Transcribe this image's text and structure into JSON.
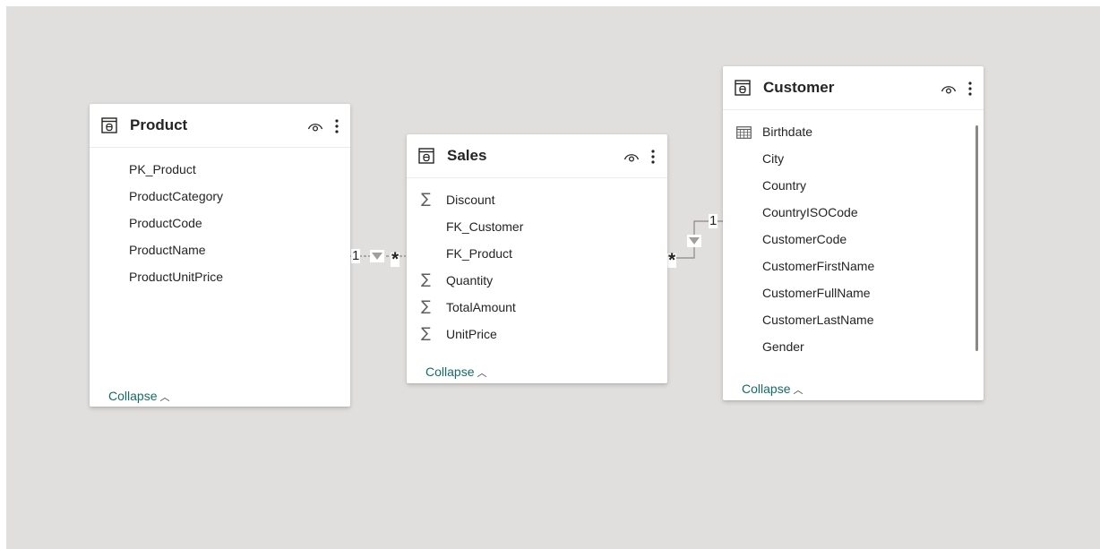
{
  "tables": {
    "product": {
      "title": "Product",
      "fields": [
        {
          "name": "PK_Product",
          "icon": "none"
        },
        {
          "name": "ProductCategory",
          "icon": "none"
        },
        {
          "name": "ProductCode",
          "icon": "none"
        },
        {
          "name": "ProductName",
          "icon": "none"
        },
        {
          "name": "ProductUnitPrice",
          "icon": "none"
        }
      ],
      "collapse_label": "Collapse"
    },
    "sales": {
      "title": "Sales",
      "fields": [
        {
          "name": "Discount",
          "icon": "sigma-icon"
        },
        {
          "name": "FK_Customer",
          "icon": "none"
        },
        {
          "name": "FK_Product",
          "icon": "none"
        },
        {
          "name": "Quantity",
          "icon": "sigma-icon"
        },
        {
          "name": "TotalAmount",
          "icon": "sigma-icon"
        },
        {
          "name": "UnitPrice",
          "icon": "sigma-icon"
        }
      ],
      "collapse_label": "Collapse"
    },
    "customer": {
      "title": "Customer",
      "fields": [
        {
          "name": "Birthdate",
          "icon": "calendar-icon"
        },
        {
          "name": "City",
          "icon": "none"
        },
        {
          "name": "Country",
          "icon": "none"
        },
        {
          "name": "CountryISOCode",
          "icon": "none"
        },
        {
          "name": "CustomerCode",
          "icon": "none"
        },
        {
          "name": "CustomerFirstName",
          "icon": "none"
        },
        {
          "name": "CustomerFullName",
          "icon": "none"
        },
        {
          "name": "CustomerLastName",
          "icon": "none"
        },
        {
          "name": "Gender",
          "icon": "none"
        }
      ],
      "collapse_label": "Collapse"
    }
  },
  "relationships": [
    {
      "from": "Product",
      "to": "Sales",
      "from_cardinality": "1",
      "to_cardinality": "*"
    },
    {
      "from": "Customer",
      "to": "Sales",
      "from_cardinality": "1",
      "to_cardinality": "*"
    }
  ],
  "icons": {
    "table": "table-icon",
    "visibility": "eye-icon",
    "more": "more-options-icon",
    "numeric": "sigma-icon",
    "date": "calendar-icon",
    "filter_direction": "filter-arrow-icon",
    "collapse": "chevron-up-icon"
  },
  "sigma_glyph": "∑",
  "colors": {
    "canvas": "#e1dfdd",
    "card": "#ffffff",
    "link": "#156b65",
    "text": "#252423",
    "line": "#8a8886"
  }
}
